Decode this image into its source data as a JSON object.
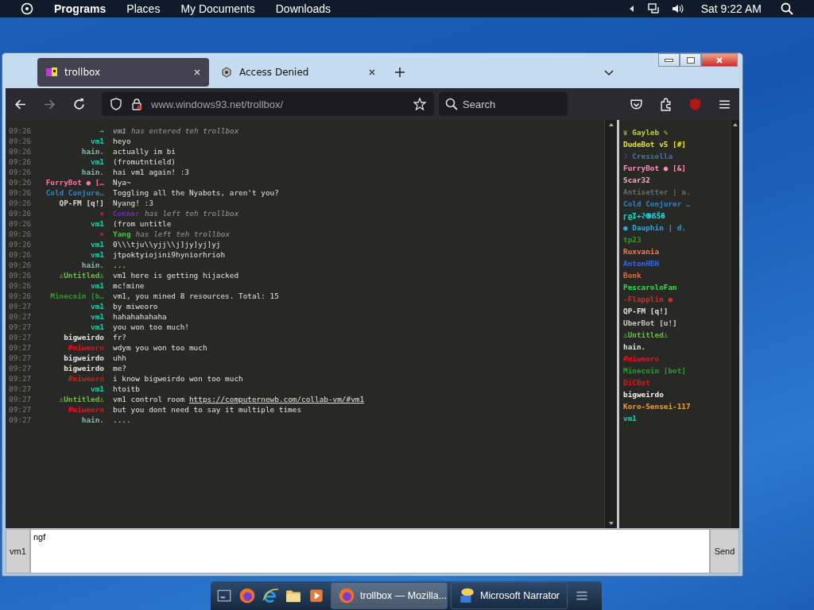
{
  "top_panel": {
    "menus": [
      "Programs",
      "Places",
      "My Documents",
      "Downloads"
    ],
    "clock": "Sat 9:22 AM"
  },
  "browser": {
    "tabs": [
      {
        "title": "trollbox",
        "selected": true
      },
      {
        "title": "Access Denied",
        "selected": false
      }
    ],
    "address": "www.windows93.net/trollbox/",
    "search": {
      "placeholder": "Search"
    }
  },
  "chat": {
    "messages": [
      {
        "kind": "join",
        "time": "09:26",
        "mark": "→",
        "who": "vm1",
        "color": "#9a9a9a",
        "text": "has entered teh trollbox"
      },
      {
        "kind": "msg",
        "time": "09:26",
        "nick": "vm1",
        "color": "#2fc3a0",
        "text": "heyo"
      },
      {
        "kind": "msg",
        "time": "09:26",
        "nick": "hain.",
        "color": "#8bb8b2",
        "text": "actually im bi"
      },
      {
        "kind": "msg",
        "time": "09:26",
        "nick": "vm1",
        "color": "#2fc3a0",
        "text": "(fromutntield)"
      },
      {
        "kind": "msg",
        "time": "09:26",
        "nick": "hain.",
        "color": "#8bb8b2",
        "text": "hai vm1 again! :3"
      },
      {
        "kind": "msg",
        "time": "09:26",
        "nick": "FurryBot ● […",
        "color": "#ff6fa8",
        "text": "Nya~"
      },
      {
        "kind": "msg",
        "time": "09:26",
        "nick": "Cold Conjure…",
        "color": "#2a86d0",
        "text": "Toggling all the Nyabots, aren't you?"
      },
      {
        "kind": "msg",
        "time": "09:26",
        "nick": "QP-FM [q!]",
        "color": "#d8d8d8",
        "text": "Nyang! :3"
      },
      {
        "kind": "leave",
        "time": "09:26",
        "mark": "×",
        "who": "Conner",
        "color": "#6a2ad0",
        "text": "has left teh trollbox"
      },
      {
        "kind": "msg",
        "time": "09:26",
        "nick": "vm1",
        "color": "#2fc3a0",
        "text": "(from untitle"
      },
      {
        "kind": "leave",
        "time": "09:26",
        "mark": "×",
        "who": "Yang",
        "color": "#3fc83f",
        "text": "has left teh trollbox"
      },
      {
        "kind": "msg",
        "time": "09:26",
        "nick": "vm1",
        "color": "#2fc3a0",
        "text": "0\\\\\\tju\\\\yjj\\\\j]jy]yj]yj"
      },
      {
        "kind": "msg",
        "time": "09:26",
        "nick": "vm1",
        "color": "#2fc3a0",
        "text": "jtpoktyiojini9hyniorhrioh"
      },
      {
        "kind": "msg",
        "time": "09:26",
        "nick": "hain.",
        "color": "#8bb8b2",
        "text": "..."
      },
      {
        "kind": "msg",
        "time": "09:26",
        "nick": "♙Untitled♙",
        "color": "#6fbf4a",
        "text": "vm1 here is getting hijacked"
      },
      {
        "kind": "msg",
        "time": "09:26",
        "nick": "vm1",
        "color": "#2fc3a0",
        "text": "mc!mine"
      },
      {
        "kind": "msg",
        "time": "09:26",
        "nick": "Minecoin [b…",
        "color": "#2f9a2f",
        "text": "vm1, you mined 8 resources. Total: 15"
      },
      {
        "kind": "msg",
        "time": "09:27",
        "nick": "vm1",
        "color": "#2fc3a0",
        "text": "by miweoro"
      },
      {
        "kind": "msg",
        "time": "09:27",
        "nick": "vm1",
        "color": "#2fc3a0",
        "text": "hahahahahaha"
      },
      {
        "kind": "msg",
        "time": "09:27",
        "nick": "vm1",
        "color": "#2fc3a0",
        "text": "you won too much!"
      },
      {
        "kind": "msg",
        "time": "09:27",
        "nick": "bigweirdo",
        "color": "#e4e4e4",
        "text": "fr?"
      },
      {
        "kind": "msg",
        "time": "09:27",
        "nick": "#miweoro",
        "color": "#d41c1c",
        "text": "wdym you won too much"
      },
      {
        "kind": "msg",
        "time": "09:27",
        "nick": "bigweirdo",
        "color": "#e4e4e4",
        "text": "uhh"
      },
      {
        "kind": "msg",
        "time": "09:27",
        "nick": "bigweirdo",
        "color": "#e4e4e4",
        "text": "me?"
      },
      {
        "kind": "msg",
        "time": "09:27",
        "nick": "#miweoro",
        "color": "#d41c1c",
        "text": "i know bigweirdo won too much"
      },
      {
        "kind": "msg",
        "time": "09:27",
        "nick": "vm1",
        "color": "#2fc3a0",
        "text": "htoitb"
      },
      {
        "kind": "msg",
        "time": "09:27",
        "nick": "♙Untitled♙",
        "color": "#6fbf4a",
        "text": "vm1 control room ",
        "link": "https://computernewb.com/collab-vm/#vm1"
      },
      {
        "kind": "msg",
        "time": "09:27",
        "nick": "#miweoro",
        "color": "#d41c1c",
        "text": "but you dont need to say it multiple times"
      },
      {
        "kind": "msg",
        "time": "09:27",
        "nick": "hain.",
        "color": "#8bb8b2",
        "text": "...."
      }
    ]
  },
  "users": [
    {
      "name": "♛ Gayleb ✎",
      "color": "#b5d33a"
    },
    {
      "name": "DudeBot v5 [#]",
      "color": "#e8e23a"
    },
    {
      "name": "☽ Cressella",
      "color": "#3a6fd0"
    },
    {
      "name": "FurryBot ● [&]",
      "color": "#ff8fb8"
    },
    {
      "name": "Scar32",
      "color": "#f2b0c0"
    },
    {
      "name": "Antisetter | a.",
      "color": "#6a6a6a"
    },
    {
      "name": "Cold Conjurer …",
      "color": "#2a86d0"
    },
    {
      "name": "ɼϱI+ϩ֍ßŜϐ",
      "color": "#16e0e0"
    },
    {
      "name": "● Dauphin | d.",
      "color": "#2aa8d8"
    },
    {
      "name": "tp23",
      "color": "#2f9a2f"
    },
    {
      "name": "Ruxvania",
      "color": "#f07a50"
    },
    {
      "name": "AntonHBH",
      "color": "#2a6ae8"
    },
    {
      "name": "Bonk",
      "color": "#e86a3a"
    },
    {
      "name": "PescaroloFan",
      "color": "#3ad84a"
    },
    {
      "name": "-Flapplin ●",
      "color": "#d82a2a"
    },
    {
      "name": "QP-FM [q!]",
      "color": "#e0e0e0"
    },
    {
      "name": "UberBot [u!]",
      "color": "#c8c8c8"
    },
    {
      "name": "♙Untitled♙",
      "color": "#6fbf4a"
    },
    {
      "name": "hain.",
      "color": "#d8e0e0"
    },
    {
      "name": "#miweoro",
      "color": "#d41c1c"
    },
    {
      "name": "Minecoin [bot]",
      "color": "#2f9a2f"
    },
    {
      "name": "DiCBot",
      "color": "#d41c1c"
    },
    {
      "name": "bigweirdo",
      "color": "#f4f4f4"
    },
    {
      "name": "Koro-Sensei-117",
      "color": "#f0a030"
    },
    {
      "name": "vm1",
      "color": "#2fc3a0"
    }
  ],
  "composer": {
    "nick": "vm1",
    "value": "ngf",
    "send": "Send"
  },
  "taskbar": {
    "windows": [
      {
        "title": "trollbox — Mozilla...",
        "selected": true
      },
      {
        "title": "Microsoft Narrator",
        "selected": false
      }
    ]
  }
}
